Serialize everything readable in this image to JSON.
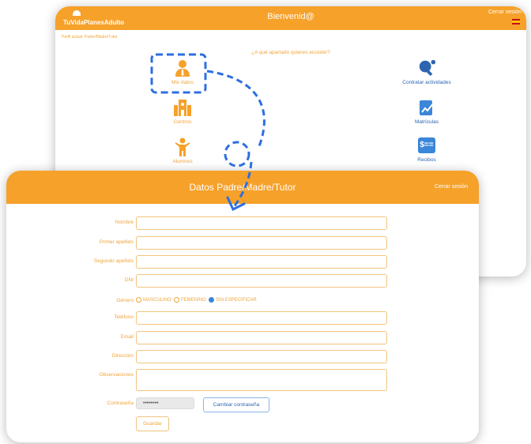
{
  "back_window": {
    "app_logo": "TuVidaPlanesAdulto",
    "header_title": "Bienvenid@",
    "logout_label": "Cerrar sesión",
    "breadcrumb": "Perfil actual: Padre/Madre/Tutor",
    "question": "¿A qué apartado quieres acceder?",
    "tiles": [
      {
        "label": "Mis datos",
        "icon": "user-tie-icon"
      },
      {
        "label": "Centros",
        "icon": "building-icon"
      },
      {
        "label": "Alumnos",
        "icon": "child-icon"
      },
      {
        "label": "Contratar actividades",
        "icon": "ping-pong-icon"
      },
      {
        "label": "Matrículas",
        "icon": "edit-document-icon"
      },
      {
        "label": "Recibos",
        "icon": "receipt-icon"
      }
    ]
  },
  "front_window": {
    "header_title": "Datos Padre/Madre/Tutor",
    "logout_label": "Cerrar sesión",
    "fields": [
      {
        "label": "Nombre"
      },
      {
        "label": "Primer apellido"
      },
      {
        "label": "Segundo apellido"
      },
      {
        "label": "DNI"
      }
    ],
    "gender": {
      "label": "Género",
      "options": [
        "MASCULINO",
        "FEMENINO",
        "SIN ESPECIFICAR"
      ],
      "selected": "SIN ESPECIFICAR"
    },
    "fields2": [
      {
        "label": "Teléfono"
      },
      {
        "label": "Email"
      },
      {
        "label": "Dirección"
      }
    ],
    "observations_label": "Observaciones",
    "password_label": "Contraseña",
    "password_value": "••••••••",
    "change_password_label": "Cambiar contraseña",
    "save_label": "Guardar"
  },
  "colors": {
    "accent": "#f6a12a",
    "highlight": "#2d6fe0",
    "link": "#2d64b0"
  }
}
